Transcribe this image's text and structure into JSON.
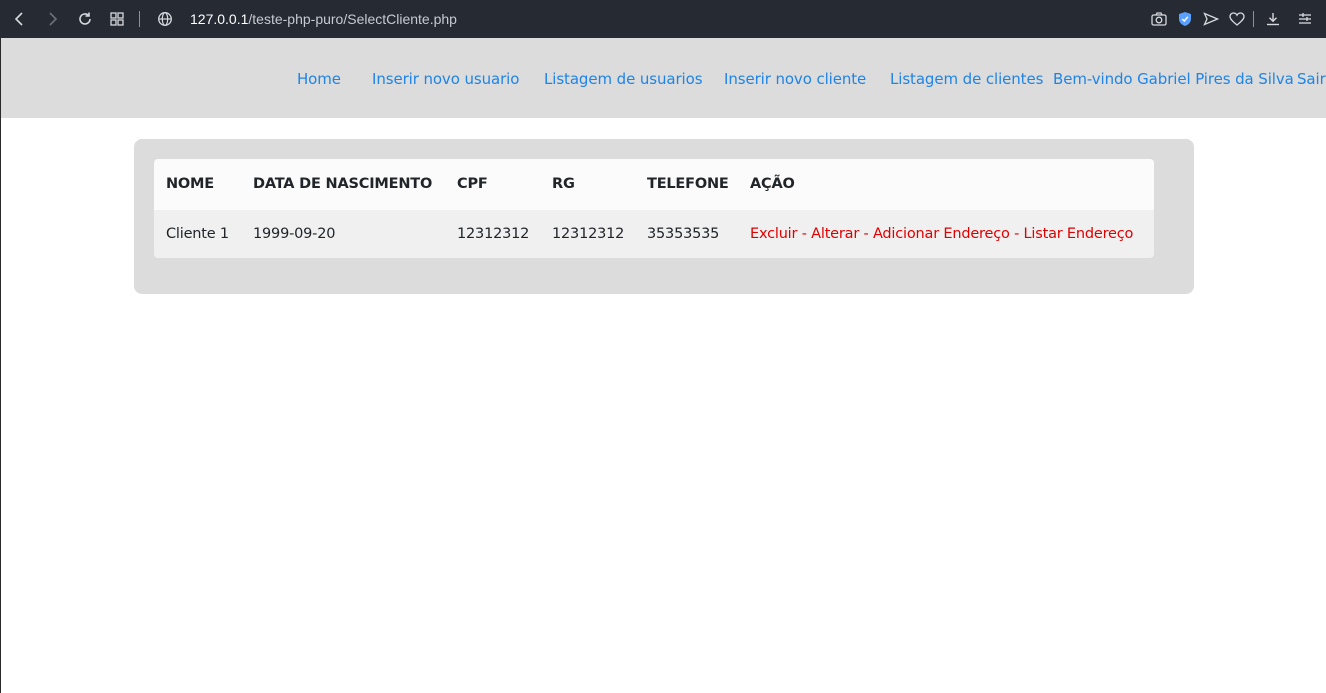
{
  "browser": {
    "url_host": "127.0.0.1",
    "url_path": "/teste-php-puro/SelectCliente.php"
  },
  "nav": {
    "home": "Home",
    "insert_user": "Inserir novo usuario",
    "list_users": "Listagem de usuarios",
    "insert_client": "Inserir novo cliente",
    "list_clients": "Listagem de clientes",
    "welcome": "Bem-vindo Gabriel Pires da Silva",
    "logout": "Sair"
  },
  "table": {
    "headers": [
      "NOME",
      "DATA DE NASCIMENTO",
      "CPF",
      "RG",
      "TELEFONE",
      "AÇÃO"
    ],
    "rows": [
      {
        "nome": "Cliente 1",
        "data_nascimento": "1999-09-20",
        "cpf": "12312312",
        "rg": "12312312",
        "telefone": "35353535",
        "actions": {
          "excluir": "Excluir",
          "alterar": "Alterar",
          "adicionar_endereco": "Adicionar Endereço",
          "listar_endereco": "Listar Endereço",
          "separator": " - "
        }
      }
    ]
  },
  "colors": {
    "link": "#1f84e6",
    "action": "#e00000",
    "nav_bg": "#dcdcdc",
    "chrome_bg": "#262a33"
  }
}
